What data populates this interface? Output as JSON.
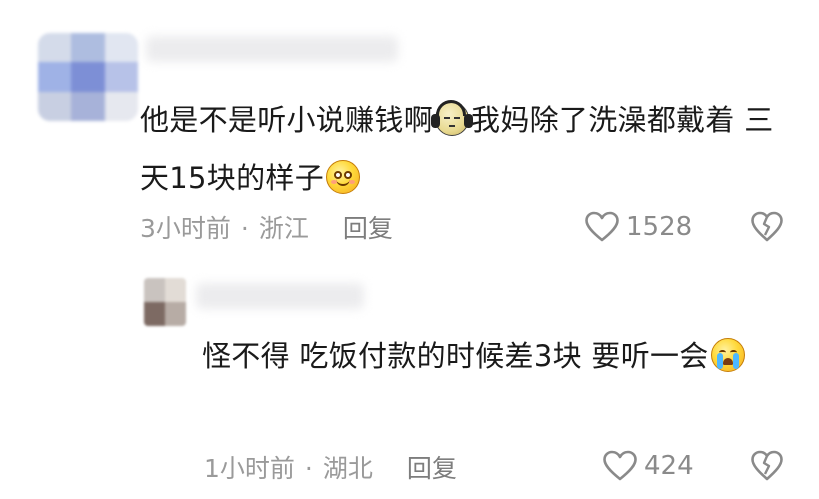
{
  "comments": [
    {
      "text_a": "他是不是听小说赚钱啊",
      "emoji_a": "headphones-face-emoji",
      "text_b": "我妈除了洗澡都戴着 三天15块的样子",
      "emoji_b": "smiling-face-emoji",
      "time": "3小时前",
      "separator": "·",
      "location": "浙江",
      "reply_label": "回复",
      "like_count": "1528"
    },
    {
      "text_a": "怪不得 吃饭付款的时候差3块 要听一会",
      "emoji_a": "crying-face-emoji",
      "time": "1小时前",
      "separator": "·",
      "location": "湖北",
      "reply_label": "回复",
      "like_count": "424"
    }
  ],
  "colors": {
    "text": "#1a1a1a",
    "meta": "#9a9a9a",
    "icon": "#8a8a8a",
    "background": "#ffffff"
  }
}
